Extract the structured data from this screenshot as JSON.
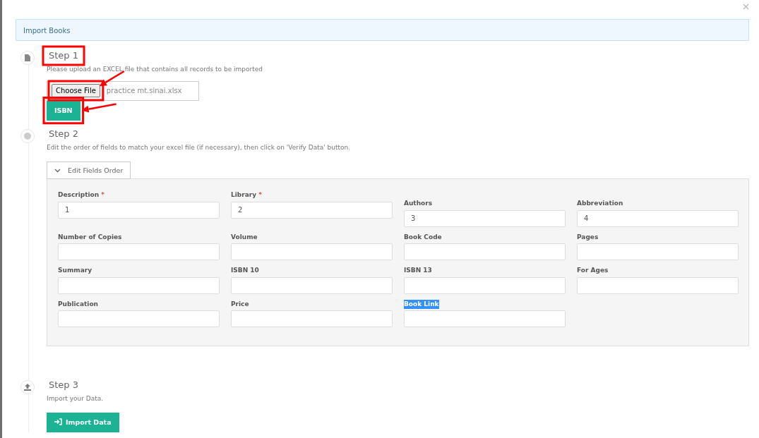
{
  "header": {
    "title": "Import Books"
  },
  "steps": [
    {
      "kind": "upload",
      "title": "Step 1",
      "description": "Please upload an EXCEL file that contains all records to be imported",
      "file_button": "Choose File",
      "file_name": "practice mt.sinai.xlsx",
      "button": "ISBN"
    },
    {
      "kind": "fields",
      "title": "Step 2",
      "description": "Edit the order of fields to match your excel file (if necessary), then click on 'Verify Data' button.",
      "toggle": {
        "label": "Edit Fields Order",
        "expanded": true
      },
      "fields": [
        {
          "label": "Description",
          "required_mark": "*",
          "value": "1"
        },
        {
          "label": "Library",
          "required_mark": "*",
          "value": "2"
        },
        {
          "label": "Authors",
          "value": "3"
        },
        {
          "label": "Abbreviation",
          "value": "4"
        },
        {
          "label": "Number of Copies"
        },
        {
          "label": "Volume"
        },
        {
          "label": "Book Code"
        },
        {
          "label": "Pages"
        },
        {
          "label": "Summary"
        },
        {
          "label": "ISBN 10"
        },
        {
          "label": "ISBN 13"
        },
        {
          "label": "For Ages"
        },
        {
          "label": "Publication"
        },
        {
          "label": "Price"
        },
        {
          "label": "Book Link",
          "text_selected": true
        }
      ]
    },
    {
      "kind": "import",
      "title": "Step 3",
      "description": "Import your Data.",
      "button": "Import Data"
    }
  ]
}
